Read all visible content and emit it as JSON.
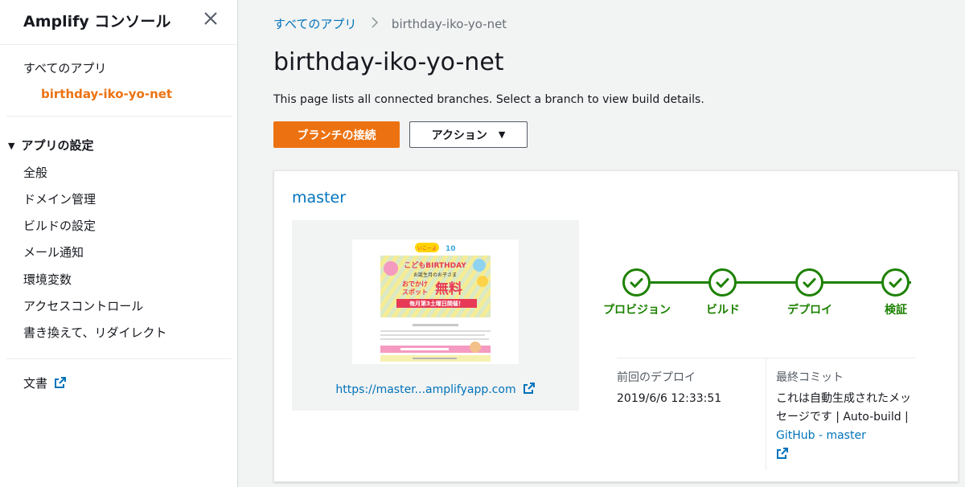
{
  "sidebar": {
    "title": "Amplify コンソール",
    "all_apps": "すべてのアプリ",
    "current_app": "birthday-iko-yo-net",
    "settings_section": "アプリの設定",
    "settings_items": [
      "全般",
      "ドメイン管理",
      "ビルドの設定",
      "メール通知",
      "環境変数",
      "アクセスコントロール",
      "書き換えて、リダイレクト"
    ],
    "docs": "文書"
  },
  "breadcrumb": {
    "root": "すべてのアプリ",
    "current": "birthday-iko-yo-net"
  },
  "page": {
    "title": "birthday-iko-yo-net",
    "description": "This page lists all connected branches. Select a branch to view build details.",
    "connect_branch_button": "ブランチの接続",
    "actions_button": "アクション"
  },
  "branch": {
    "name": "master",
    "preview_url": "https://master...amplifyapp.com",
    "stages": [
      "プロビジョン",
      "ビルド",
      "デプロイ",
      "検証"
    ],
    "last_deploy_label": "前回のデプロイ",
    "last_deploy_value": "2019/6/6 12:33:51",
    "last_commit_label": "最終コミット",
    "commit_message": "これは自動生成されたメッセージです",
    "commit_separator": "| Auto-build |",
    "commit_link": "GitHub - master"
  },
  "thumbnail": {
    "logo_text": "いこーよ",
    "anniversary": "10",
    "banner_text": "こどもBIRTHDAY",
    "sub_text": "お誕生月のお子さま",
    "line1": "おでかけ",
    "line2": "スポット",
    "free_text": "無料",
    "schedule_text": "毎月第3土曜日開催！"
  },
  "colors": {
    "accent": "#ec7211",
    "link": "#0073bb",
    "success": "#1d8102"
  }
}
